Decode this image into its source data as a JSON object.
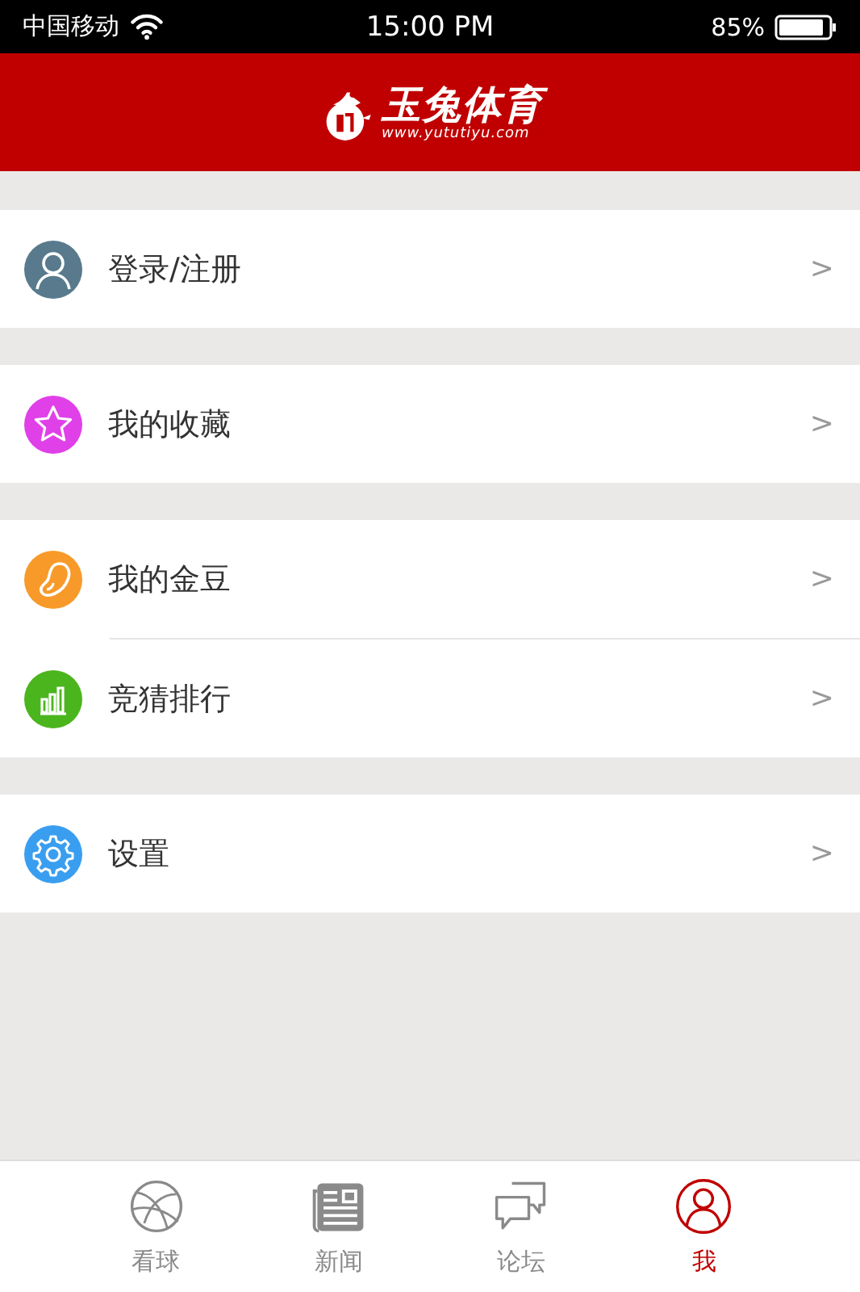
{
  "status_bar": {
    "carrier": "中国移动",
    "time": "15:00 PM",
    "battery": "85%"
  },
  "header": {
    "logo_title": "玉兔体育",
    "logo_url": "www.yututiyu.com"
  },
  "menu_groups": [
    {
      "items": [
        {
          "label": "登录/注册",
          "kind": "user",
          "color": "#587a8c",
          "chevron": ">"
        }
      ]
    },
    {
      "items": [
        {
          "label": "我的收藏",
          "kind": "star",
          "color": "#e040e8",
          "chevron": ">"
        }
      ]
    },
    {
      "items": [
        {
          "label": "我的金豆",
          "kind": "bean",
          "color": "#f79a2a",
          "chevron": ">"
        },
        {
          "label": "竞猜排行",
          "kind": "chart",
          "color": "#4bb51e",
          "chevron": ">"
        }
      ]
    },
    {
      "items": [
        {
          "label": "设置",
          "kind": "gear",
          "color": "#3a9ef0",
          "chevron": ">"
        }
      ]
    }
  ],
  "tab_bar": [
    {
      "label": "看球",
      "kind": "ball",
      "selected": false
    },
    {
      "label": "新闻",
      "kind": "news",
      "selected": false
    },
    {
      "label": "论坛",
      "kind": "chat",
      "selected": false
    },
    {
      "label": "我",
      "kind": "me",
      "selected": true
    }
  ]
}
